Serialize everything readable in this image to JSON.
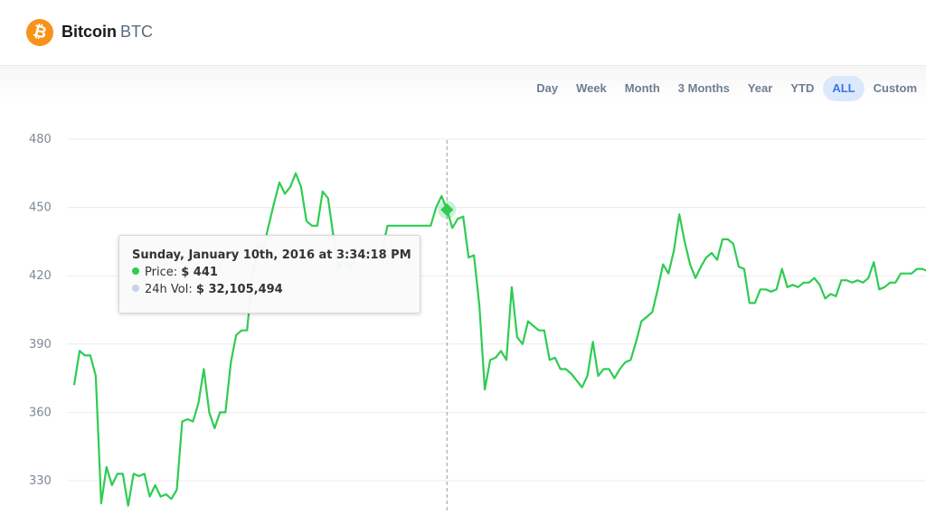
{
  "header": {
    "coin_name": "Bitcoin",
    "coin_symbol": "BTC",
    "logo_glyph": "₿",
    "brand_color": "#f7931a"
  },
  "range_tabs": [
    {
      "label": "Day",
      "active": false
    },
    {
      "label": "Week",
      "active": false
    },
    {
      "label": "Month",
      "active": false
    },
    {
      "label": "3 Months",
      "active": false
    },
    {
      "label": "Year",
      "active": false
    },
    {
      "label": "YTD",
      "active": false
    },
    {
      "label": "ALL",
      "active": true
    },
    {
      "label": "Custom",
      "active": false
    }
  ],
  "tooltip": {
    "title": "Sunday, January 10th, 2016 at 3:34:18 PM",
    "price_label": "Price:",
    "price_value": "$ 441",
    "volume_label": "24h Vol:",
    "volume_value": "$ 32,105,494",
    "price_color": "#2ecc52",
    "volume_color": "#c5d3e6"
  },
  "chart_data": {
    "type": "line",
    "line_color": "#2ecc52",
    "grid": true,
    "ylim": [
      318,
      482
    ],
    "yticks": [
      330,
      360,
      390,
      420,
      450,
      480
    ],
    "hover_index": 69,
    "series": [
      {
        "values": [
          372,
          387,
          385,
          385,
          376,
          320,
          336,
          328,
          333,
          333,
          319,
          333,
          332,
          333,
          323,
          328,
          323,
          324,
          322,
          326,
          356,
          357,
          356,
          364,
          379,
          360,
          353,
          360,
          360,
          382,
          394,
          396,
          396,
          420,
          434,
          432,
          442,
          452,
          461,
          456,
          459,
          465,
          459,
          444,
          442,
          442,
          457,
          454,
          437,
          423,
          429,
          423,
          427,
          432,
          427,
          431,
          431,
          431,
          442,
          442,
          442,
          442,
          442,
          442,
          442,
          442,
          442,
          450,
          455,
          449,
          441,
          445,
          446,
          428,
          429,
          407,
          370,
          383,
          384,
          387,
          383,
          415,
          393,
          390,
          400,
          398,
          396,
          396,
          383,
          384,
          379,
          379,
          377,
          374,
          371,
          376,
          391,
          376,
          379,
          379,
          375,
          379,
          382,
          383,
          391,
          400,
          402,
          404,
          414,
          425,
          421,
          431,
          447,
          435,
          425,
          419,
          424,
          428,
          430,
          427,
          436,
          436,
          434,
          424,
          423,
          408,
          408,
          414,
          414,
          413,
          414,
          423,
          415,
          416,
          415,
          417,
          417,
          419,
          416,
          410,
          412,
          411,
          418,
          418,
          417,
          418,
          417,
          419,
          426,
          414,
          415,
          417,
          417,
          421,
          421,
          421,
          423,
          423,
          422
        ]
      }
    ]
  }
}
